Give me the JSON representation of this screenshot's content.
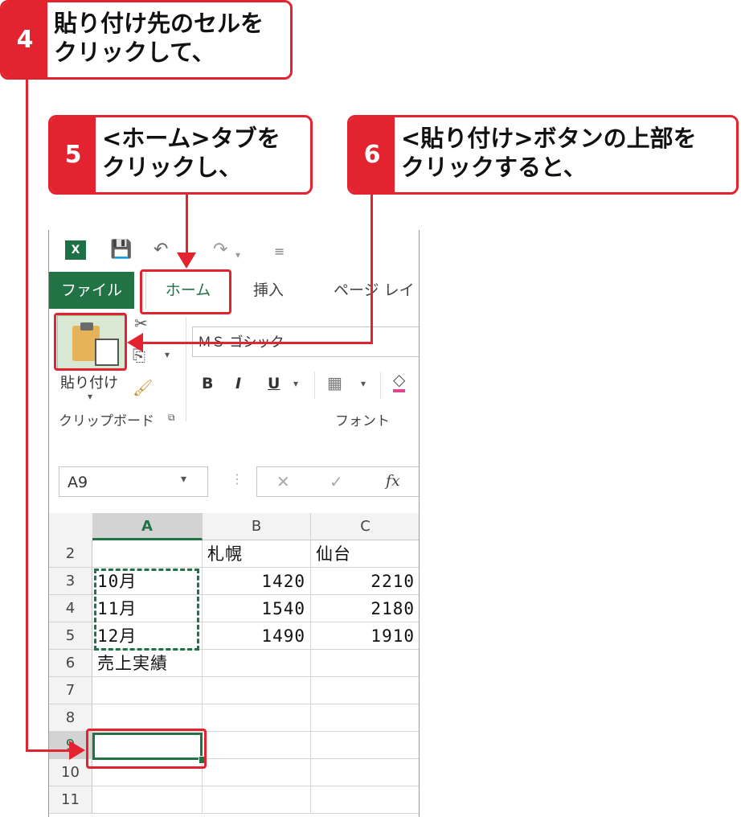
{
  "callouts": {
    "c4": {
      "num": "4",
      "text": "貼り付け先のセルを\nクリックして、"
    },
    "c5": {
      "num": "5",
      "text": "<ホーム>タブを\nクリックし、"
    },
    "c6": {
      "num": "6",
      "text": "<貼り付け>ボタンの上部を\nクリックすると、"
    }
  },
  "tabs": {
    "file": "ファイル",
    "home": "ホーム",
    "insert": "挿入",
    "layout": "ページ レイア"
  },
  "ribbon": {
    "paste_label": "貼り付け",
    "paste_arrow": "▾",
    "clipboard_group": "クリップボード",
    "font_group": "フォント",
    "font_name": "ＭＳ ゴシック",
    "bold": "B",
    "italic": "I",
    "underline": "U"
  },
  "formula_bar": {
    "namebox": "A9",
    "cancel": "✕",
    "enter": "✓",
    "fx": "fx"
  },
  "grid": {
    "columns": [
      "A",
      "B",
      "C"
    ],
    "rows": [
      {
        "n": "2",
        "a": "",
        "b": "札幌",
        "c": "仙台"
      },
      {
        "n": "3",
        "a": "10月",
        "b": "1420",
        "c": "2210"
      },
      {
        "n": "4",
        "a": "11月",
        "b": "1540",
        "c": "2180"
      },
      {
        "n": "5",
        "a": "12月",
        "b": "1490",
        "c": "1910"
      },
      {
        "n": "6",
        "a": "売上実績",
        "b": "",
        "c": ""
      },
      {
        "n": "7",
        "a": "",
        "b": "",
        "c": ""
      },
      {
        "n": "8",
        "a": "",
        "b": "",
        "c": ""
      },
      {
        "n": "9",
        "a": "",
        "b": "",
        "c": ""
      },
      {
        "n": "10",
        "a": "",
        "b": "",
        "c": ""
      },
      {
        "n": "11",
        "a": "",
        "b": "",
        "c": ""
      }
    ]
  },
  "colors": {
    "accent_red": "#e32330",
    "excel_green": "#217346"
  }
}
